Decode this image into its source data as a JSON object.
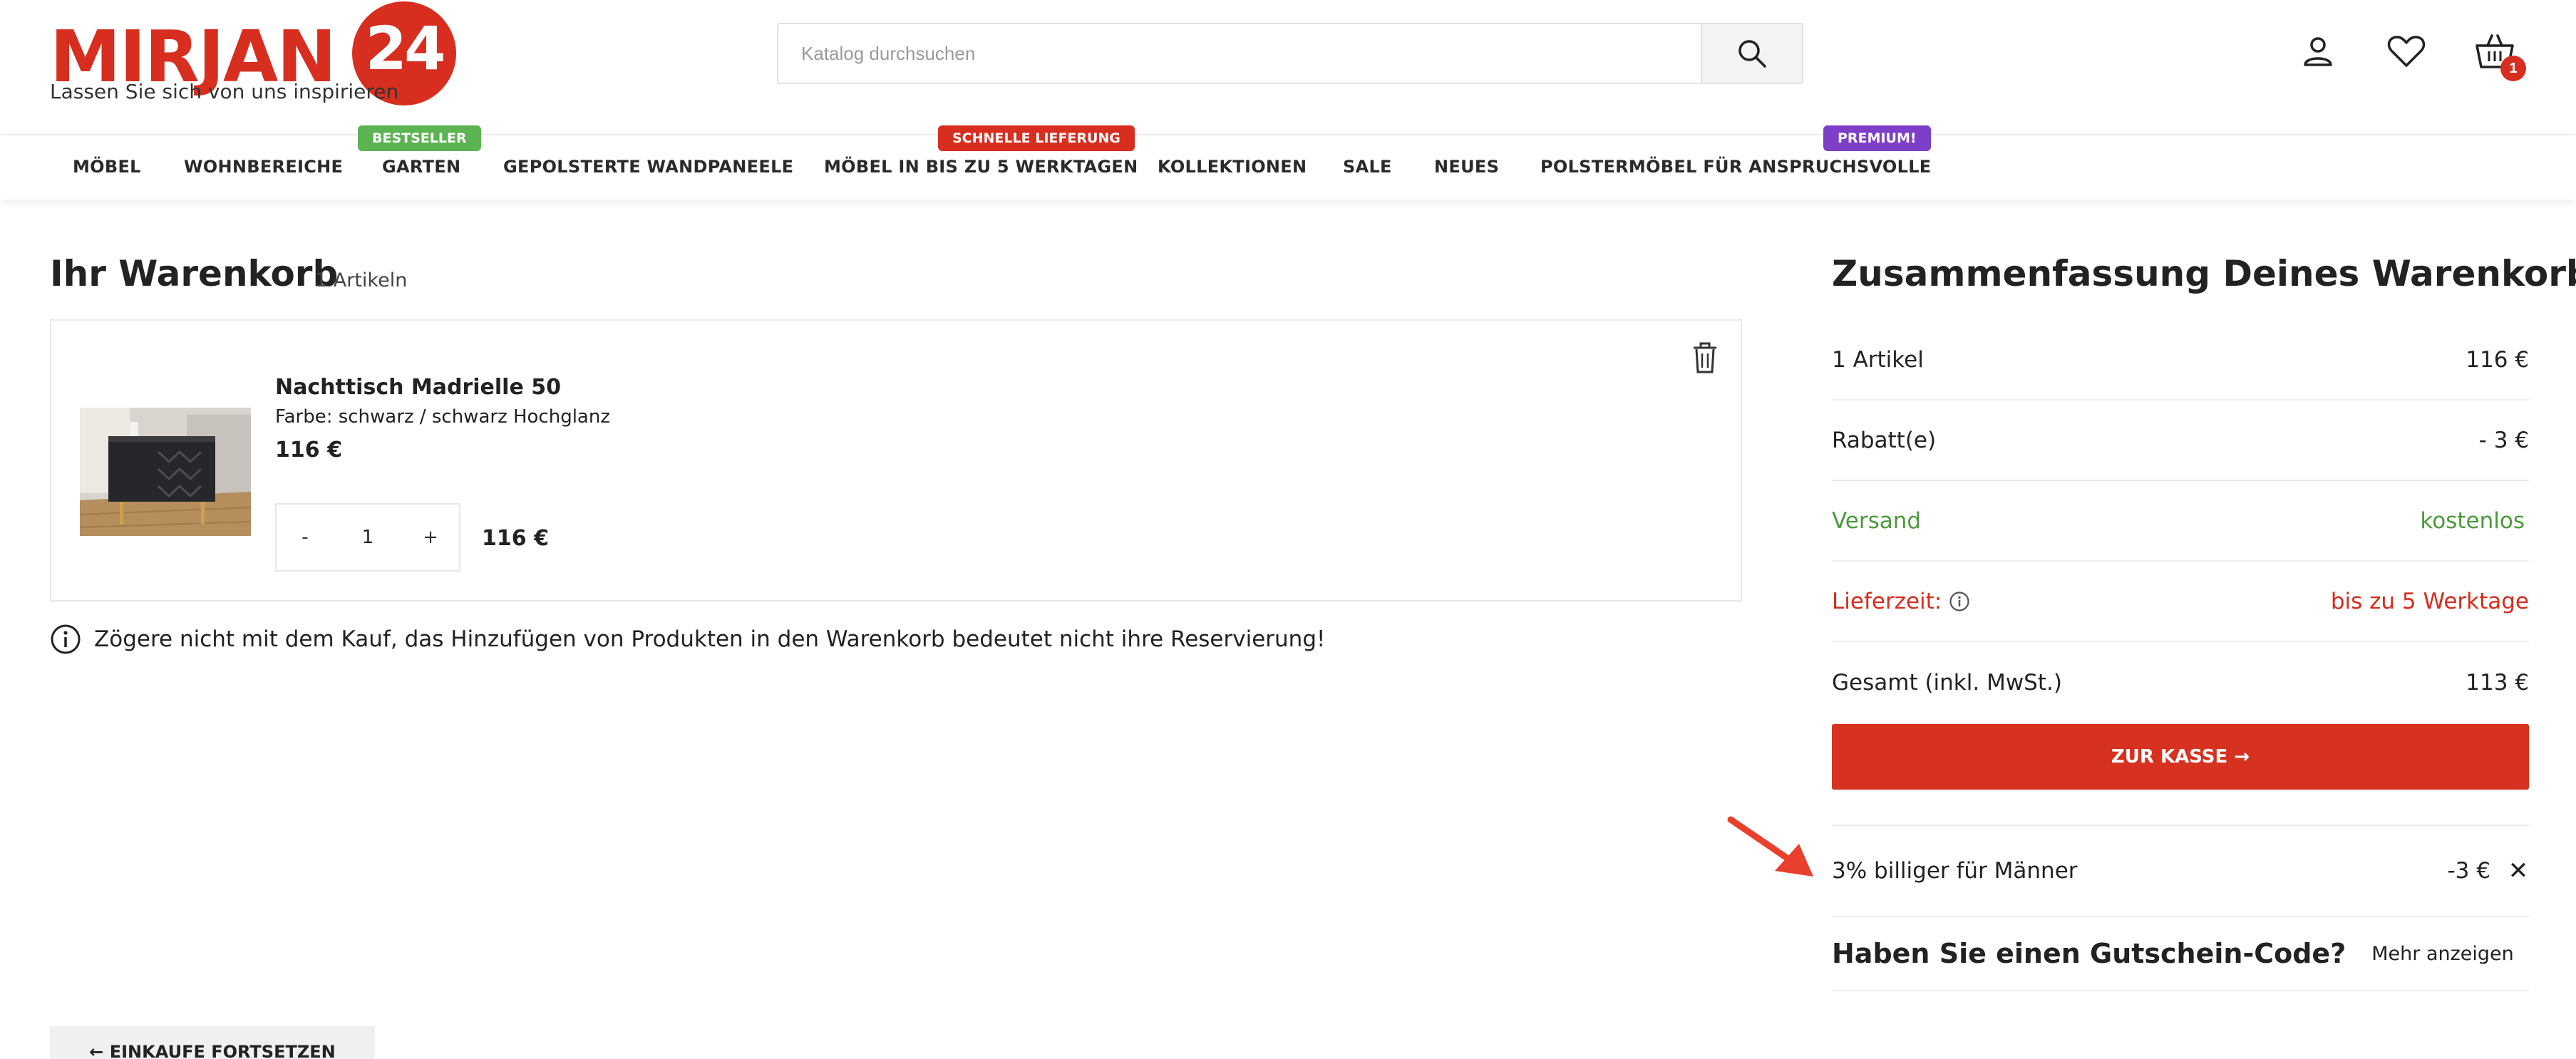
{
  "header": {
    "logo_text": "MIRJAN",
    "logo_number": "24",
    "logo_tagline": "Lassen Sie sich von uns inspirieren",
    "search_placeholder": "Katalog durchsuchen",
    "cart_count": "1",
    "icons": [
      "search-icon",
      "user-icon",
      "heart-icon",
      "basket-icon"
    ]
  },
  "nav": {
    "items": [
      "MÖBEL",
      "WOHNBEREICHE",
      "GARTEN",
      "GEPOLSTERTE WANDPANEELE",
      "MÖBEL IN BIS ZU 5 WERKTAGEN",
      "KOLLEKTIONEN",
      "SALE",
      "NEUES",
      "POLSTERMÖBEL FÜR ANSPRUCHSVOLLE"
    ],
    "badges": {
      "bestseller": "BESTSELLER",
      "fast_delivery": "SCHNELLE LIEFERUNG",
      "premium": "PREMIUM!"
    },
    "badge_colors": {
      "bestseller": "#5cb352",
      "fast_delivery": "#d72e20",
      "premium": "#7d3fc8"
    }
  },
  "cart": {
    "title": "Ihr Warenkorb",
    "count_label": "1 Artikeln",
    "item": {
      "name": "Nachttisch Madrielle 50",
      "variant": "Farbe: schwarz / schwarz Hochglanz",
      "price": "116 €",
      "qty_minus": "-",
      "quantity": "1",
      "qty_plus": "+",
      "total": "116 €"
    },
    "notice": "Zögere nicht mit dem Kauf, das Hinzufügen von Produkten in den Warenkorb bedeutet nicht ihre Reservierung!",
    "continue_label": "← EINKAUFE FORTSETZEN"
  },
  "summary": {
    "title": "Zusammenfassung Deines Warenkorbs",
    "rows": {
      "items_label": "1 Artikel",
      "items_value": "116 €",
      "discount_label": "Rabatt(e)",
      "discount_value": "- 3 €",
      "shipping_label": "Versand",
      "shipping_value": "kostenlos",
      "delivery_label": "Lieferzeit:",
      "delivery_value": "bis zu 5 Werktage",
      "total_label": "Gesamt (inkl. MwSt.)",
      "total_value": "113 €"
    },
    "checkout_label": "ZUR KASSE →",
    "applied_discount": {
      "name": "3% billiger für Männer",
      "value": "-3 €",
      "remove": "✕"
    },
    "coupon_title": "Haben Sie einen Gutschein-Code?",
    "coupon_more": "Mehr anzeigen"
  },
  "colors": {
    "brand_red": "#d72e20",
    "checkout_red": "#d7311f",
    "shipping_green": "#4b9a3a",
    "delivery_red": "#d52d1c"
  }
}
